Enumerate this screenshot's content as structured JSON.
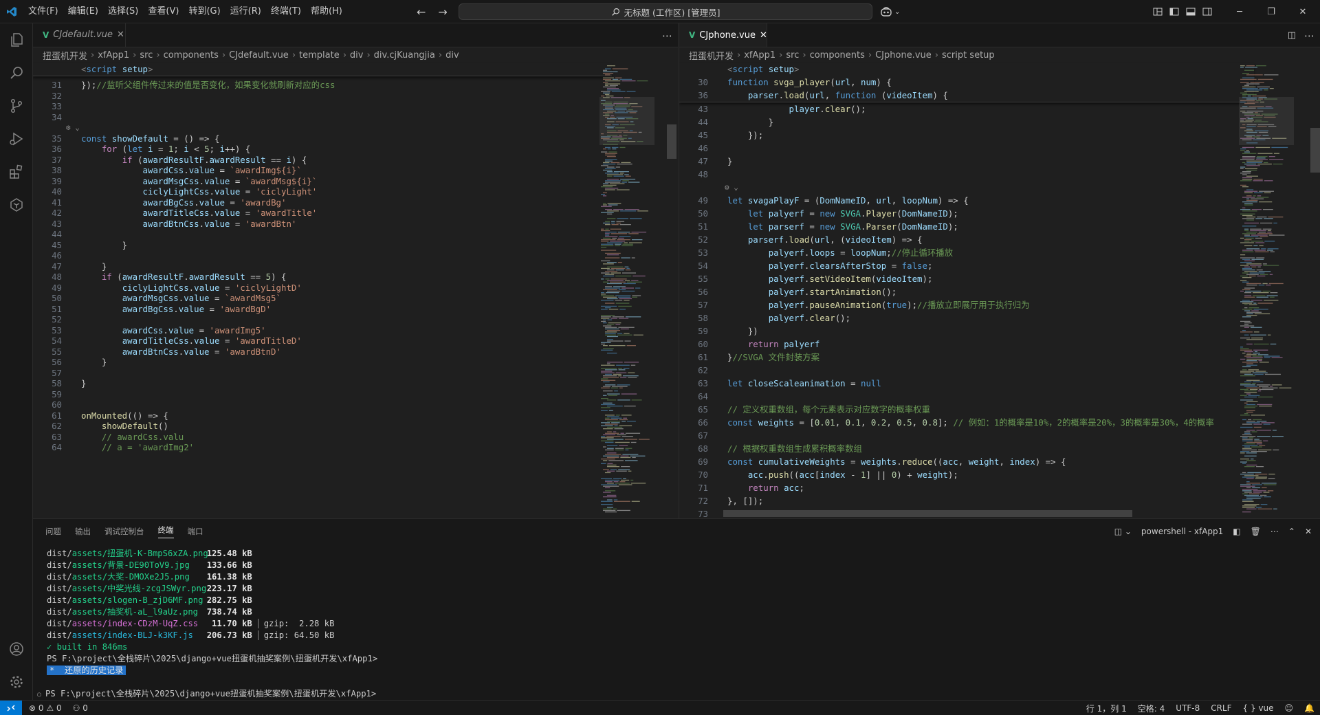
{
  "menu": [
    "文件(F)",
    "编辑(E)",
    "选择(S)",
    "查看(V)",
    "转到(G)",
    "运行(R)",
    "终端(T)",
    "帮助(H)"
  ],
  "command_center": "无标题 (工作区) [管理员]",
  "left_editor": {
    "tab": "CJdefault.vue",
    "breadcrumb": [
      "扭蛋机开发",
      "xfApp1",
      "src",
      "components",
      "CJdefault.vue",
      "template",
      "div",
      "div.cjKuangjia",
      "div"
    ],
    "sticky": {
      "ln": "",
      "text": "<script setup>"
    },
    "lines": [
      {
        "n": "31",
        "t": "});//监听父组件传过来的值是否变化，如果变化就刷新对应的css"
      },
      {
        "n": "32",
        "t": ""
      },
      {
        "n": "33",
        "t": ""
      },
      {
        "n": "34",
        "t": ""
      },
      {
        "n": "",
        "t": ""
      },
      {
        "n": "35",
        "t": "const showDefault = () => {"
      },
      {
        "n": "36",
        "t": "    for (let i = 1; i < 5; i++) {"
      },
      {
        "n": "37",
        "t": "        if (awardResultF.awardResult == i) {"
      },
      {
        "n": "38",
        "t": "            awardCss.value = `awardImg${i}`"
      },
      {
        "n": "39",
        "t": "            awardMsgCss.value = `awardMsg${i}`"
      },
      {
        "n": "40",
        "t": "            ciclyLightCss.value = 'ciclyLight'"
      },
      {
        "n": "41",
        "t": "            awardBgCss.value = 'awardBg'"
      },
      {
        "n": "42",
        "t": "            awardTitleCss.value = 'awardTitle'"
      },
      {
        "n": "43",
        "t": "            awardBtnCss.value = 'awardBtn'"
      },
      {
        "n": "44",
        "t": ""
      },
      {
        "n": "45",
        "t": "        }"
      },
      {
        "n": "46",
        "t": ""
      },
      {
        "n": "47",
        "t": "    }"
      },
      {
        "n": "48",
        "t": "    if (awardResultF.awardResult == 5) {"
      },
      {
        "n": "49",
        "t": "        ciclyLightCss.value = 'ciclyLightD'"
      },
      {
        "n": "50",
        "t": "        awardMsgCss.value = `awardMsg5`"
      },
      {
        "n": "51",
        "t": "        awardBgCss.value = 'awardBgD'"
      },
      {
        "n": "52",
        "t": ""
      },
      {
        "n": "53",
        "t": "        awardCss.value = 'awardImg5'"
      },
      {
        "n": "54",
        "t": "        awardTitleCss.value = 'awardTitleD'"
      },
      {
        "n": "55",
        "t": "        awardBtnCss.value = 'awardBtnD'"
      },
      {
        "n": "56",
        "t": "    }"
      },
      {
        "n": "57",
        "t": ""
      },
      {
        "n": "58",
        "t": "}"
      },
      {
        "n": "59",
        "t": ""
      },
      {
        "n": "60",
        "t": ""
      },
      {
        "n": "61",
        "t": "onMounted(() => {"
      },
      {
        "n": "62",
        "t": "    showDefault()"
      },
      {
        "n": "63",
        "t": "    // awardCss.valu"
      },
      {
        "n": "64",
        "t": "    // a = 'awardImg2'"
      }
    ]
  },
  "right_editor": {
    "tab": "CJphone.vue",
    "breadcrumb": [
      "扭蛋机开发",
      "xfApp1",
      "src",
      "components",
      "CJphone.vue",
      "script setup"
    ],
    "sticky": [
      {
        "n": "",
        "t": "<script setup>"
      },
      {
        "n": "30",
        "t": "function svga_player(url, num) {"
      },
      {
        "n": "36",
        "t": "    parser.load(url, function (videoItem) {"
      }
    ],
    "lines": [
      {
        "n": "43",
        "t": "            player.clear();"
      },
      {
        "n": "44",
        "t": "        }"
      },
      {
        "n": "45",
        "t": "    });"
      },
      {
        "n": "46",
        "t": ""
      },
      {
        "n": "47",
        "t": "}"
      },
      {
        "n": "48",
        "t": ""
      },
      {
        "n": "",
        "t": ""
      },
      {
        "n": "49",
        "t": "let svagaPlayF = (DomNameID, url, loopNum) => {"
      },
      {
        "n": "50",
        "t": "    let palyerf = new SVGA.Player(DomNameID);"
      },
      {
        "n": "51",
        "t": "    let parserf = new SVGA.Parser(DomNameID);"
      },
      {
        "n": "52",
        "t": "    parserf.load(url, (videoItem) => {"
      },
      {
        "n": "53",
        "t": "        palyerf.loops = loopNum;//停止循环播放"
      },
      {
        "n": "54",
        "t": "        palyerf.clearsAfterStop = false;"
      },
      {
        "n": "55",
        "t": "        palyerf.setVideoItem(videoItem);"
      },
      {
        "n": "56",
        "t": "        palyerf.startAnimation();"
      },
      {
        "n": "57",
        "t": "        palyerf.pauseAnimation(true);//播放立即展厅用于执行归为"
      },
      {
        "n": "58",
        "t": "        palyerf.clear();"
      },
      {
        "n": "59",
        "t": "    })"
      },
      {
        "n": "60",
        "t": "    return palyerf"
      },
      {
        "n": "61",
        "t": "}//SVGA 文件封装方案"
      },
      {
        "n": "62",
        "t": ""
      },
      {
        "n": "63",
        "t": "let closeScaleanimation = null"
      },
      {
        "n": "64",
        "t": ""
      },
      {
        "n": "65",
        "t": "// 定义权重数组，每个元素表示对应数字的概率权重"
      },
      {
        "n": "66",
        "t": "const weights = [0.01, 0.1, 0.2, 0.5, 0.8]; // 例如：1的概率是10%，2的概率是20%，3的概率是30%，4的概率"
      },
      {
        "n": "67",
        "t": ""
      },
      {
        "n": "68",
        "t": "// 根据权重数组生成累积概率数组"
      },
      {
        "n": "69",
        "t": "const cumulativeWeights = weights.reduce((acc, weight, index) => {"
      },
      {
        "n": "70",
        "t": "    acc.push((acc[index - 1] || 0) + weight);"
      },
      {
        "n": "71",
        "t": "    return acc;"
      },
      {
        "n": "72",
        "t": "}, []);"
      },
      {
        "n": "73",
        "t": ""
      }
    ]
  },
  "panel": {
    "tabs": [
      "问题",
      "输出",
      "调试控制台",
      "终端",
      "端口"
    ],
    "active_tab": "终端",
    "terminal_name": "powershell - xfApp1",
    "terminal_lines": [
      {
        "dir": "dist/",
        "path": "assets/扭蛋机-K-BmpS6xZA.png",
        "size": "125.48 kB",
        "gzip": ""
      },
      {
        "dir": "dist/",
        "path": "assets/背景-DE90ToV9.jpg",
        "size": "133.66 kB",
        "gzip": ""
      },
      {
        "dir": "dist/",
        "path": "assets/大奖-DMOXe2J5.png",
        "size": "161.38 kB",
        "gzip": ""
      },
      {
        "dir": "dist/",
        "path": "assets/中奖光线-zcgJSWyr.png",
        "size": "223.17 kB",
        "gzip": ""
      },
      {
        "dir": "dist/",
        "path": "assets/slogen-B_zjD6MF.png",
        "size": "282.75 kB",
        "gzip": ""
      },
      {
        "dir": "dist/",
        "path": "assets/抽奖机-aL_l9aUz.png",
        "size": "738.74 kB",
        "gzip": ""
      },
      {
        "dir": "dist/",
        "path": "assets/index-CDzM-UqZ.css",
        "size": "11.70 kB",
        "gzip": "gzip:  2.28 kB"
      },
      {
        "dir": "dist/",
        "path": "assets/index-BLJ-k3KF.js",
        "size": "206.73 kB",
        "gzip": "gzip: 64.50 kB"
      }
    ],
    "built": "✓ built in 846ms",
    "prompt1": "PS F:\\project\\全栈碎片\\2025\\django+vue扭蛋机抽奖案例\\扭蛋机开发\\xfApp1>",
    "history": "*  还原的历史记录",
    "prompt2": "PS F:\\project\\全栈碎片\\2025\\django+vue扭蛋机抽奖案例\\扭蛋机开发\\xfApp1>"
  },
  "statusbar": {
    "errors": "0",
    "warnings": "0",
    "ports": "0",
    "position": "行 1，列 1",
    "spaces": "空格: 4",
    "encoding": "UTF-8",
    "eol": "CRLF",
    "language": "vue"
  },
  "colors": {
    "accent": "#0078d4",
    "vue_green": "#41b883"
  }
}
